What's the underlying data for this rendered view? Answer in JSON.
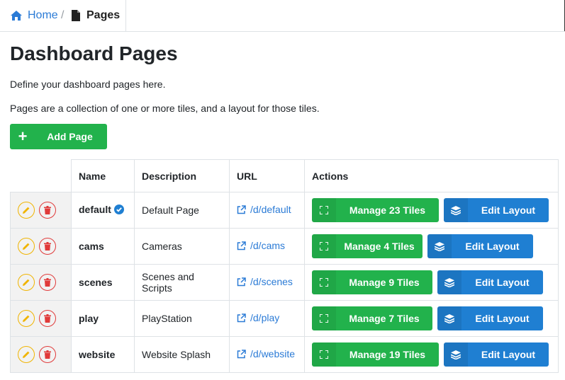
{
  "breadcrumb": {
    "home": "Home",
    "separator": "/",
    "current": "Pages"
  },
  "page": {
    "title": "Dashboard Pages",
    "description1": "Define your dashboard pages here.",
    "description2": "Pages are a collection of one or more tiles, and a layout for those tiles."
  },
  "add_button": {
    "label": "Add Page",
    "icon": "plus-icon"
  },
  "table": {
    "headers": [
      "Name",
      "Description",
      "URL",
      "Actions"
    ],
    "rows": [
      {
        "name": "default",
        "verified": true,
        "description": "Default Page",
        "url": "/d/default",
        "manage": "Manage 23 Tiles",
        "edit": "Edit Layout"
      },
      {
        "name": "cams",
        "verified": false,
        "description": "Cameras",
        "url": "/d/cams",
        "manage": "Manage 4 Tiles",
        "edit": "Edit Layout"
      },
      {
        "name": "scenes",
        "verified": false,
        "description": "Scenes and Scripts",
        "url": "/d/scenes",
        "manage": "Manage 9 Tiles",
        "edit": "Edit Layout"
      },
      {
        "name": "play",
        "verified": false,
        "description": "PlayStation",
        "url": "/d/play",
        "manage": "Manage 7 Tiles",
        "edit": "Edit Layout"
      },
      {
        "name": "website",
        "verified": false,
        "description": "Website Splash",
        "url": "/d/website",
        "manage": "Manage 19 Tiles",
        "edit": "Edit Layout"
      }
    ]
  },
  "colors": {
    "green": "#22b24c",
    "blue": "#1f7fd2",
    "link": "#2b7bd6",
    "edit_outline": "#f0b400",
    "delete_outline": "#e03a3a"
  }
}
